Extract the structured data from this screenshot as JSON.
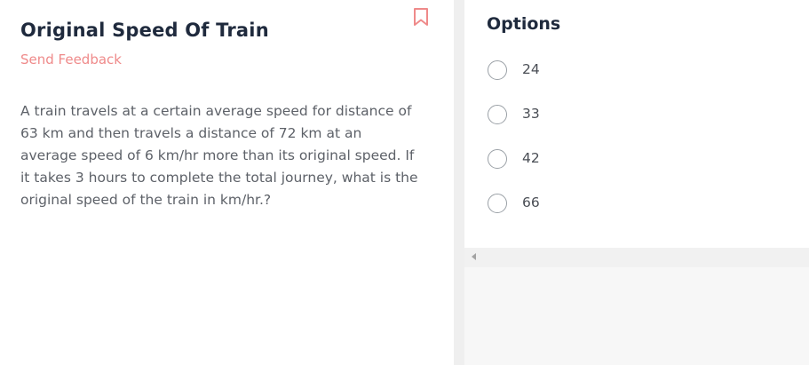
{
  "question_panel": {
    "title": "Original Speed Of Train",
    "feedback_label": "Send Feedback",
    "question_text": "A train travels at a certain average speed for distance of 63 km and then travels a distance of 72 km at an average speed of 6 km/hr more than its original speed. If it takes 3 hours to complete the total journey, what is the original speed of the train in km/hr.?",
    "bookmark_icon": "bookmark-icon"
  },
  "options_panel": {
    "heading": "Options",
    "options": [
      {
        "label": "24"
      },
      {
        "label": "33"
      },
      {
        "label": "42"
      },
      {
        "label": "66"
      }
    ]
  },
  "colors": {
    "title": "#1f2a3d",
    "feedback": "#ef8a8a",
    "bookmark": "#ef8a8a",
    "body_text": "#5d6168",
    "divider": "#efefef"
  }
}
